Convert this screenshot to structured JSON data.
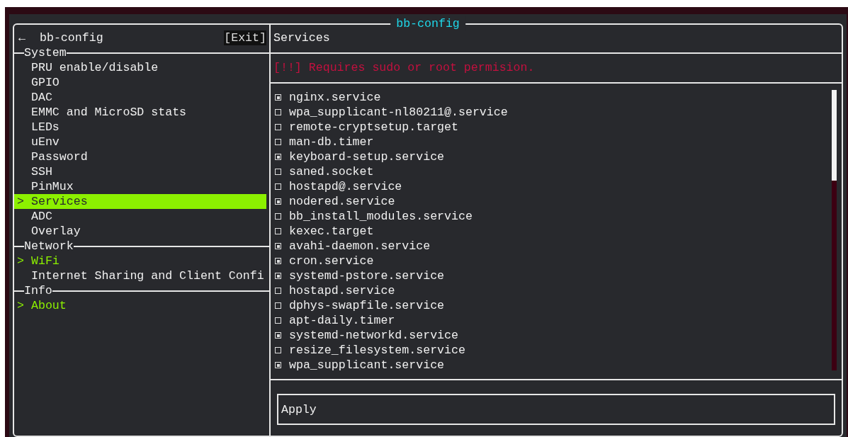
{
  "window": {
    "title": "bb-config"
  },
  "header": {
    "back": "←",
    "title": "bb-config",
    "exit": "[Exit]"
  },
  "menu": [
    {
      "heading": "System",
      "focused": true,
      "items": [
        {
          "label": "PRU enable/disable",
          "selected": false
        },
        {
          "label": "GPIO",
          "selected": false
        },
        {
          "label": "DAC",
          "selected": false
        },
        {
          "label": "EMMC and MicroSD stats",
          "selected": false
        },
        {
          "label": "LEDs",
          "selected": false
        },
        {
          "label": "uEnv",
          "selected": false
        },
        {
          "label": "Password",
          "selected": false
        },
        {
          "label": "SSH",
          "selected": false
        },
        {
          "label": "PinMux",
          "selected": false
        },
        {
          "label": "Services",
          "selected": true,
          "marker": ">"
        },
        {
          "label": "ADC",
          "selected": false
        },
        {
          "label": "Overlay",
          "selected": false
        }
      ]
    },
    {
      "heading": "Network",
      "focused": false,
      "items": [
        {
          "label": "WiFi",
          "selected": true,
          "marker": ">"
        },
        {
          "label": "Internet Sharing and Client Confi",
          "selected": false
        }
      ]
    },
    {
      "heading": "Info",
      "focused": false,
      "items": [
        {
          "label": "About",
          "selected": true,
          "marker": ">"
        }
      ]
    }
  ],
  "panel": {
    "title": "Services",
    "warning": "[!!] Requires sudo or root permision.",
    "services": [
      {
        "name": "nginx.service",
        "checked": true
      },
      {
        "name": "wpa_supplicant-nl80211@.service",
        "checked": false
      },
      {
        "name": "remote-cryptsetup.target",
        "checked": false
      },
      {
        "name": "man-db.timer",
        "checked": false
      },
      {
        "name": "keyboard-setup.service",
        "checked": true
      },
      {
        "name": "saned.socket",
        "checked": false
      },
      {
        "name": "hostapd@.service",
        "checked": false
      },
      {
        "name": "nodered.service",
        "checked": true
      },
      {
        "name": "bb_install_modules.service",
        "checked": false
      },
      {
        "name": "kexec.target",
        "checked": false
      },
      {
        "name": "avahi-daemon.service",
        "checked": true
      },
      {
        "name": "cron.service",
        "checked": true
      },
      {
        "name": "systemd-pstore.service",
        "checked": true
      },
      {
        "name": "hostapd.service",
        "checked": false
      },
      {
        "name": "dphys-swapfile.service",
        "checked": false
      },
      {
        "name": "apt-daily.timer",
        "checked": false
      },
      {
        "name": "systemd-networkd.service",
        "checked": true
      },
      {
        "name": "resize_filesystem.service",
        "checked": false
      },
      {
        "name": "wpa_supplicant.service",
        "checked": true
      }
    ],
    "apply": "Apply"
  }
}
